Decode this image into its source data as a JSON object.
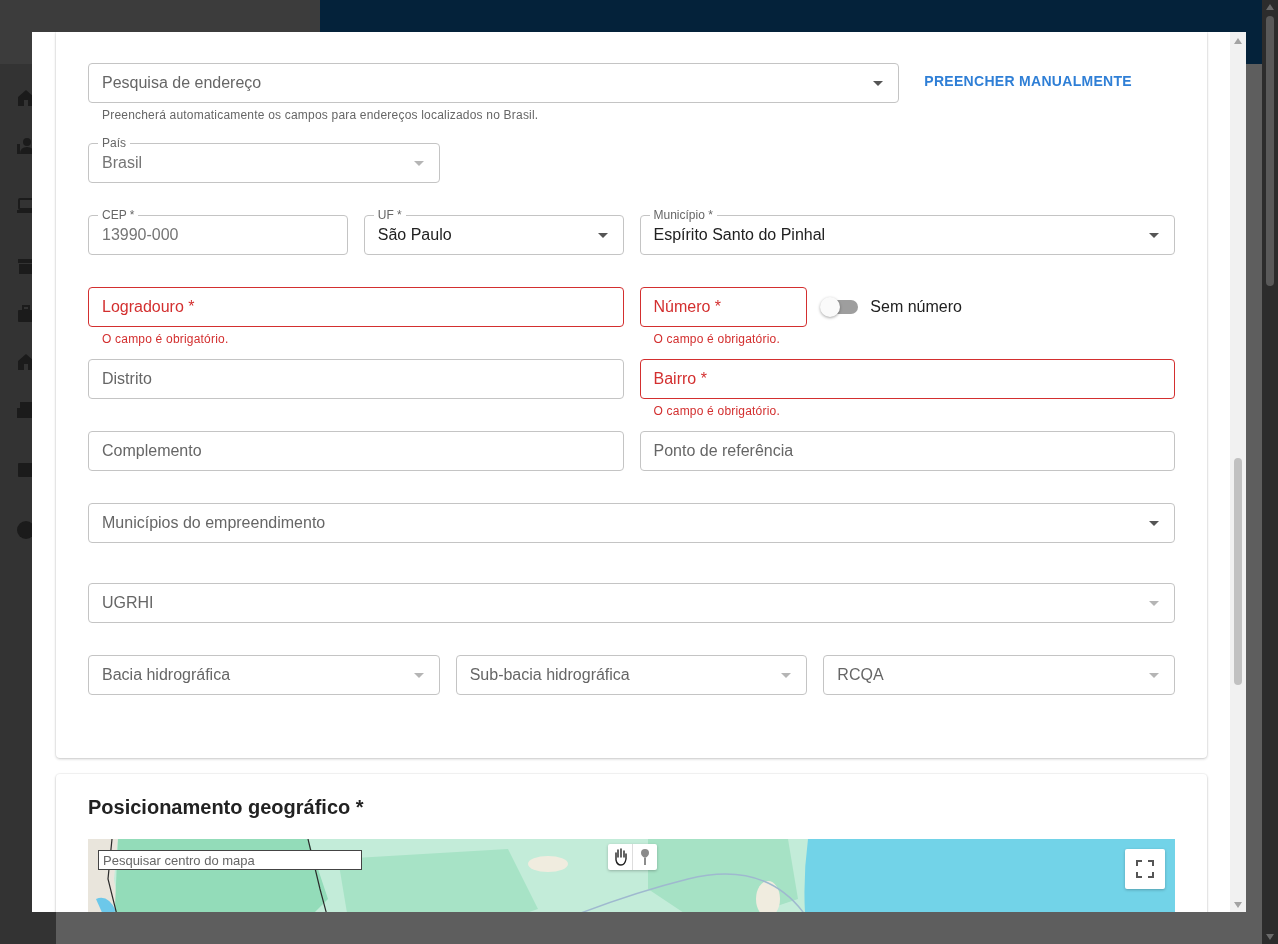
{
  "address_form": {
    "rows": [
      {
        "fields": [
          {
            "kind": "select",
            "label": "Pesquisa de endereço",
            "helper": "Preencherá automaticamente os campos para endereços localizados no Brasil.",
            "error": false,
            "disabled": false
          },
          {
            "kind": "link",
            "label": "PREENCHER MANUALMENTE"
          }
        ]
      },
      {
        "fields": [
          {
            "kind": "select",
            "label": "País",
            "value": "Brasil",
            "error": false,
            "disabled": true
          }
        ]
      },
      {
        "fields": [
          {
            "kind": "text",
            "label": "CEP *",
            "value": "13990-000",
            "error": false,
            "disabled": true
          },
          {
            "kind": "select",
            "label": "UF *",
            "value": "São Paulo",
            "error": false,
            "disabled": false
          },
          {
            "kind": "select",
            "label": "Município *",
            "value": "Espírito Santo do Pinhal",
            "error": false,
            "disabled": false
          }
        ]
      },
      {
        "fields": [
          {
            "kind": "text",
            "label": "Logradouro *",
            "helper": "O campo é obrigatório.",
            "error": true
          },
          {
            "kind": "text",
            "label": "Número *",
            "helper": "O campo é obrigatório.",
            "error": true
          },
          {
            "kind": "toggle",
            "label": "Sem número",
            "on": false
          }
        ]
      },
      {
        "fields": [
          {
            "kind": "text",
            "label": "Distrito",
            "error": false
          },
          {
            "kind": "text",
            "label": "Bairro *",
            "helper": "O campo é obrigatório.",
            "error": true
          }
        ]
      },
      {
        "fields": [
          {
            "kind": "text",
            "label": "Complemento",
            "error": false
          },
          {
            "kind": "text",
            "label": "Ponto de referência",
            "error": false
          }
        ]
      },
      {
        "fields": [
          {
            "kind": "select",
            "label": "Municípios do empreendimento",
            "error": false,
            "disabled": false
          }
        ]
      },
      {
        "fields": [
          {
            "kind": "select",
            "label": "UGRHI",
            "error": false,
            "disabled": true
          }
        ]
      },
      {
        "fields": [
          {
            "kind": "select",
            "label": "Bacia hidrográfica",
            "error": false,
            "disabled": true
          },
          {
            "kind": "select",
            "label": "Sub-bacia hidrográfica",
            "error": false,
            "disabled": true
          },
          {
            "kind": "select",
            "label": "RCQA",
            "error": false,
            "disabled": true
          }
        ]
      }
    ]
  },
  "geo_card": {
    "title": "Posicionamento geográfico *",
    "map": {
      "search_placeholder": "Pesquisar centro do mapa"
    }
  }
}
